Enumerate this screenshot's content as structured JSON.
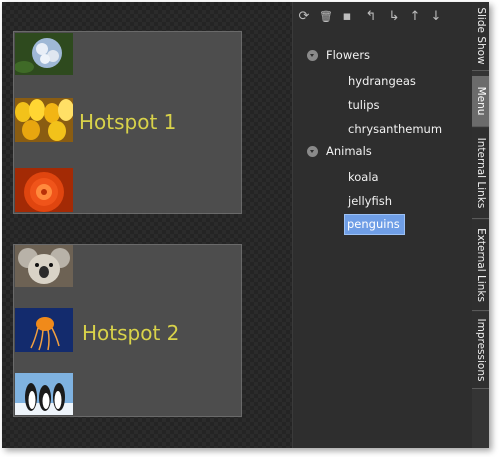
{
  "toolbar": {
    "icons": [
      {
        "name": "refresh-icon",
        "glyph": "⟳"
      },
      {
        "name": "delete-icon",
        "glyph": "🗑"
      },
      {
        "name": "save-icon",
        "glyph": "▪"
      },
      {
        "name": "indent-left-icon",
        "glyph": "↰"
      },
      {
        "name": "indent-right-icon",
        "glyph": "↳"
      },
      {
        "name": "move-up-icon",
        "glyph": "↑"
      },
      {
        "name": "move-down-icon",
        "glyph": "↓"
      }
    ]
  },
  "canvas": {
    "hotspot1": {
      "label": "Hotspot 1",
      "thumbs": [
        {
          "name": "hydrangeas-thumb",
          "colors": [
            "#2e4a1e",
            "#9fb8d6",
            "#e8eef7"
          ]
        },
        {
          "name": "tulips-thumb",
          "colors": [
            "#8a5d12",
            "#f2c21a",
            "#ffe066"
          ]
        },
        {
          "name": "chrysanthemum-thumb",
          "colors": [
            "#a32a05",
            "#f0541a",
            "#ff8a3d"
          ]
        }
      ]
    },
    "hotspot2": {
      "label": "Hotspot 2",
      "thumbs": [
        {
          "name": "koala-thumb",
          "colors": [
            "#6d6254",
            "#b8b2a8",
            "#d9d3c7"
          ]
        },
        {
          "name": "jellyfish-thumb",
          "colors": [
            "#0a1a4a",
            "#1c3b8f",
            "#f08a1a"
          ]
        },
        {
          "name": "penguins-thumb",
          "colors": [
            "#7fb2e0",
            "#ffffff",
            "#1a1a1a"
          ]
        }
      ]
    }
  },
  "tree": {
    "groups": [
      {
        "label": "Flowers",
        "items": [
          "hydrangeas",
          "tulips",
          "chrysanthemum"
        ]
      },
      {
        "label": "Animals",
        "items": [
          "koala",
          "jellyfish",
          "penguins"
        ]
      }
    ],
    "selected": "penguins"
  },
  "tabs": [
    {
      "label": "Slide Show",
      "active": false
    },
    {
      "label": "Menu",
      "active": true
    },
    {
      "label": "Internal Links",
      "active": false
    },
    {
      "label": "External Links",
      "active": false
    },
    {
      "label": "Impressions",
      "active": false
    }
  ]
}
